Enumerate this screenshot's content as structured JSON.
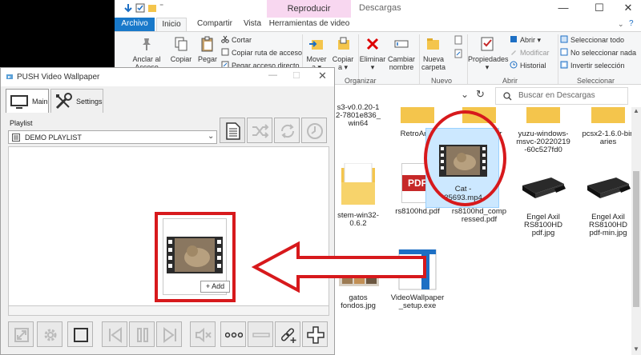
{
  "explorer": {
    "title": "Descargas",
    "context_tab": "Reproducir",
    "tabs": [
      "Archivo",
      "Inicio",
      "Compartir",
      "Vista",
      "Herramientas de video"
    ],
    "window_controls": [
      "—",
      "☐",
      "✕"
    ],
    "ribbon": {
      "pin_label": "Anclar al\nAcceso rápido",
      "copy_label": "Copiar",
      "paste_label": "Pegar",
      "cut_label": "Cortar",
      "copy_path_label": "Copiar ruta de acceso",
      "paste_shortcut_label": "Pegar acceso directo",
      "move_label": "Mover\na ▾",
      "copy_to_label": "Copiar\na ▾",
      "delete_label": "Eliminar\n▾",
      "rename_label": "Cambiar\nnombre",
      "new_folder_label": "Nueva\ncarpeta",
      "properties_label": "Propiedades\n▾",
      "open_label": "Abrir ▾",
      "modify_label": "Modificar",
      "history_label": "Historial",
      "select_all_label": "Seleccionar todo",
      "select_none_label": "No seleccionar nada",
      "invert_label": "Invertir selección",
      "group_organize": "Organizar",
      "group_new": "Nuevo",
      "group_open": "Abrir",
      "group_select": "Seleccionar"
    },
    "search_placeholder": "Buscar en Descargas",
    "files": [
      {
        "name": "s3-v0.0.20-1\n2-7801e836_\nwin64",
        "type": "folder"
      },
      {
        "name": "RetroArch",
        "type": "folder"
      },
      {
        "name": "xenia_master",
        "type": "folder"
      },
      {
        "name": "yuzu-windows-\nmsvc-20220219\n-60c527fd0",
        "type": "folder"
      },
      {
        "name": "pcsx2-1.6.0-bin\naries",
        "type": "folder"
      },
      {
        "name": "stem-win32-\n0.6.2",
        "type": "folder"
      },
      {
        "name": "rs8100hd.pdf",
        "type": "pdf"
      },
      {
        "name": "rs8100hd_comp\nressed.pdf",
        "type": "pdf"
      },
      {
        "name": "Engel Axil\nRS8100HD\npdf.jpg",
        "type": "image"
      },
      {
        "name": "Engel Axil\nRS8100HD\npdf-min.jpg",
        "type": "image"
      },
      {
        "name": "gatos\nfondos.jpg",
        "type": "image"
      },
      {
        "name": "VideoWallpaper\n_setup.exe",
        "type": "exe"
      },
      {
        "name": "Cat -\n35693.mp4",
        "type": "video"
      }
    ],
    "pdf_icon_text": "PDF"
  },
  "push": {
    "title": "PUSH Video Wallpaper",
    "tabs": [
      "Main",
      "Settings"
    ],
    "playlist_label": "Playlist",
    "playlist_value": "DEMO PLAYLIST",
    "add_button": "+ Add",
    "accent_color": "#1a6fb5",
    "annotation_color": "#d7191c"
  }
}
